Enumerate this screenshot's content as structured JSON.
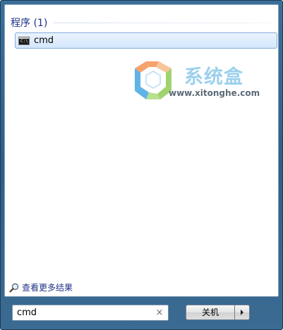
{
  "results": {
    "section_title": "程序 (1)",
    "items": [
      {
        "label": "cmd",
        "icon": "command-prompt-icon"
      }
    ]
  },
  "watermark": {
    "brand": "系统盒",
    "url": "www.xitonghe.com"
  },
  "see_more": {
    "label": "查看更多结果",
    "icon": "magnifier-icon"
  },
  "search": {
    "value": "cmd",
    "clear_icon": "×"
  },
  "shutdown": {
    "label": "关机",
    "options_icon": "triangle-right-icon"
  },
  "colors": {
    "accent_text": "#1e3287",
    "selection_border": "#84acdd",
    "frame": "#2e5f86"
  }
}
